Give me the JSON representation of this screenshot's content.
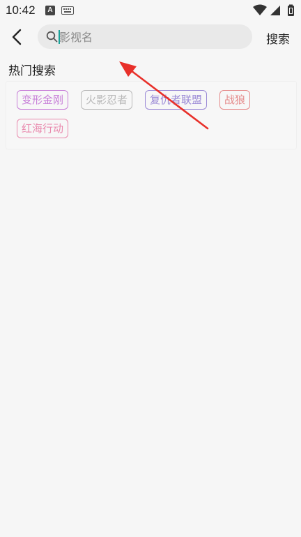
{
  "status_bar": {
    "time": "10:42",
    "icons": [
      "a-notification-icon",
      "keyboard-icon",
      "wifi-icon",
      "signal-icon",
      "battery-icon"
    ]
  },
  "header": {
    "back_icon": "chevron-left-icon",
    "search_placeholder": "影视名",
    "search_value": "",
    "search_icon": "search-icon",
    "search_button_label": "搜索"
  },
  "hot_search": {
    "title": "热门搜索",
    "tags": [
      {
        "label": "变形金刚",
        "color": "#c77ed8"
      },
      {
        "label": "火影忍者",
        "color": "#b9b9b9"
      },
      {
        "label": "复仇者联盟",
        "color": "#9b8ad6"
      },
      {
        "label": "战狼",
        "color": "#e58a8a"
      },
      {
        "label": "红海行动",
        "color": "#e989ad"
      }
    ]
  },
  "colors": {
    "background": "#f6f6f6",
    "search_box": "#e9e9e9",
    "caret": "#1aa29a",
    "annotation_arrow": "#e8302a"
  }
}
